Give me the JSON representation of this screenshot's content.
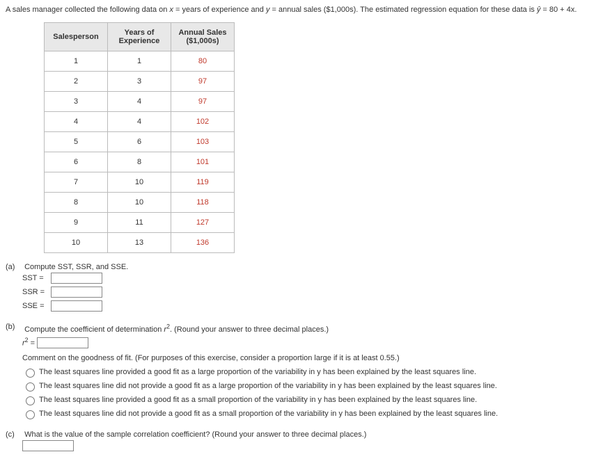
{
  "intro": {
    "text_prefix": "A sales manager collected the following data on ",
    "var_x": "x",
    "text_x": " = years of experience and ",
    "var_y": "y",
    "text_y": " = annual sales ($1,000s). The estimated regression equation for these data is ",
    "yhat": "ŷ",
    "equation": " = 80 + 4x."
  },
  "table": {
    "headers": {
      "col1": "Salesperson",
      "col2_line1": "Years of",
      "col2_line2": "Experience",
      "col3_line1": "Annual Sales",
      "col3_line2": "($1,000s)"
    },
    "rows": [
      {
        "sp": "1",
        "yrs": "1",
        "sales": "80"
      },
      {
        "sp": "2",
        "yrs": "3",
        "sales": "97"
      },
      {
        "sp": "3",
        "yrs": "4",
        "sales": "97"
      },
      {
        "sp": "4",
        "yrs": "4",
        "sales": "102"
      },
      {
        "sp": "5",
        "yrs": "6",
        "sales": "103"
      },
      {
        "sp": "6",
        "yrs": "8",
        "sales": "101"
      },
      {
        "sp": "7",
        "yrs": "10",
        "sales": "119"
      },
      {
        "sp": "8",
        "yrs": "10",
        "sales": "118"
      },
      {
        "sp": "9",
        "yrs": "11",
        "sales": "127"
      },
      {
        "sp": "10",
        "yrs": "13",
        "sales": "136"
      }
    ]
  },
  "part_a": {
    "label": "(a)",
    "text": "Compute SST, SSR, and SSE.",
    "sst_label": "SST =",
    "ssr_label": "SSR =",
    "sse_label": "SSE ="
  },
  "part_b": {
    "label": "(b)",
    "text_prefix": "Compute the coefficient of determination ",
    "r2": "r",
    "text_suffix": ". (Round your answer to three decimal places.)",
    "r2_eq_prefix": "r",
    "r2_eq_suffix": " =",
    "comment": "Comment on the goodness of fit. (For purposes of this exercise, consider a proportion large if it is at least 0.55.)",
    "options": [
      "The least squares line provided a good fit as a large proportion of the variability in y has been explained by the least squares line.",
      "The least squares line did not provide a good fit as a large proportion of the variability in y has been explained by the least squares line.",
      "The least squares line provided a good fit as a small proportion of the variability in y has been explained by the least squares line.",
      "The least squares line did not provide a good fit as a small proportion of the variability in y has been explained by the least squares line."
    ]
  },
  "part_c": {
    "label": "(c)",
    "text": "What is the value of the sample correlation coefficient? (Round your answer to three decimal places.)"
  }
}
